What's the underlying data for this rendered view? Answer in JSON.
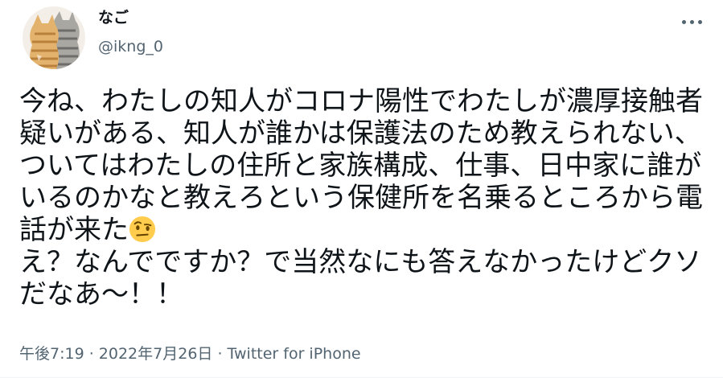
{
  "author": {
    "display_name": "なご",
    "handle": "@ikng_0",
    "avatar_icon": "two-tabby-cats-avatar"
  },
  "more_icon": "more-options-icon",
  "tweet": {
    "text_before_emoji": "今ね、わたしの知人がコロナ陽性でわたしが濃厚接触者疑いがある、知人が誰かは保護法のため教えられない、ついてはわたしの住所と家族構成、仕事、日中家に誰がいるのかなと教えろという保健所を名乗るところから電話が来た",
    "emoji": "face-with-raised-eyebrow",
    "text_after_emoji": "え？なんでですか？で当然なにも答えなかったけどクソだなあ〜！！"
  },
  "meta": {
    "time": "午後7:19",
    "separator1": " · ",
    "date": "2022年7月26日",
    "separator2": " · ",
    "source": "Twitter for iPhone"
  },
  "colors": {
    "text": "#0f1419",
    "secondary": "#536471",
    "emoji_face": "#ffcc4d"
  }
}
